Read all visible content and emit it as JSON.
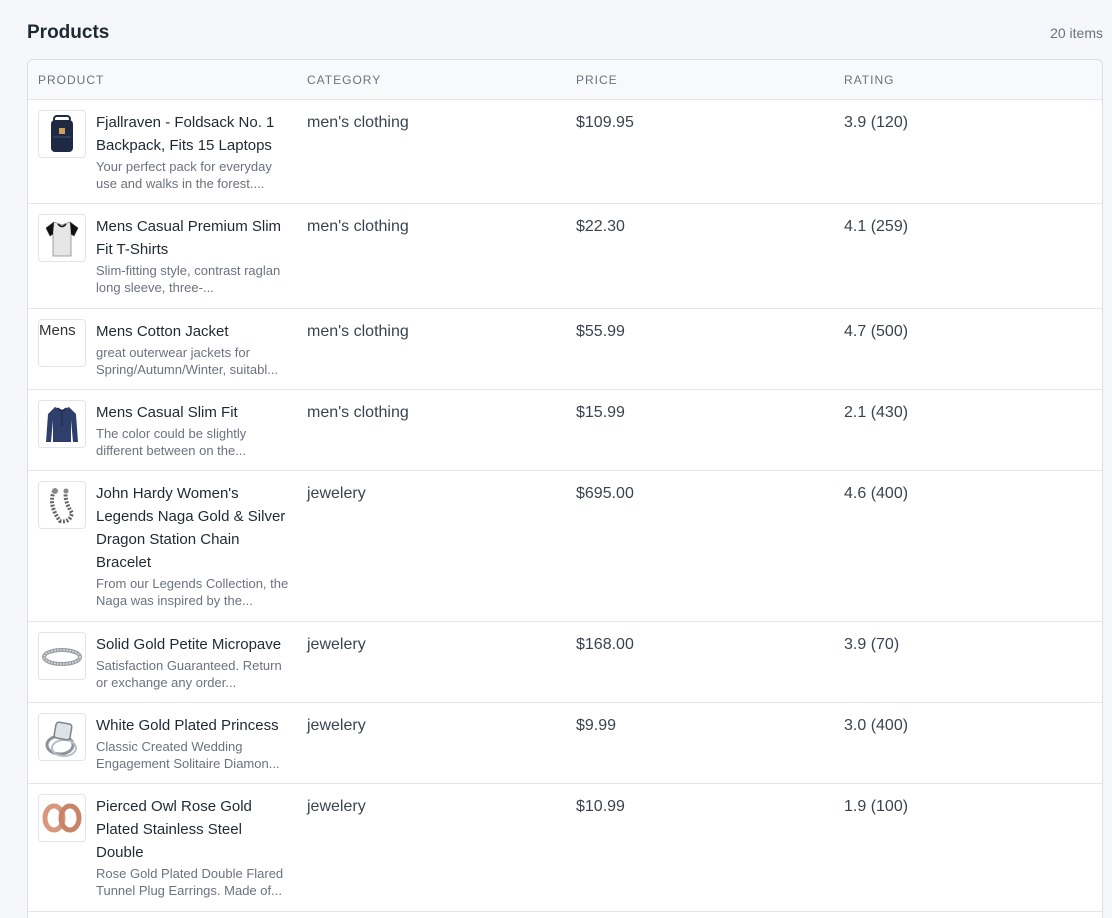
{
  "header": {
    "title": "Products",
    "count": "20 items"
  },
  "columns": {
    "product": "PRODUCT",
    "category": "CATEGORY",
    "price": "PRICE",
    "rating": "RATING"
  },
  "rows": [
    {
      "name": "Fjallraven - Foldsack No. 1 Backpack, Fits 15 Laptops",
      "desc": "Your perfect pack for everyday use and walks in the forest....",
      "category": "men's clothing",
      "price": "$109.95",
      "rating": "3.9 (120)",
      "icon": "backpack-image"
    },
    {
      "name": "Mens Casual Premium Slim Fit T-Shirts",
      "desc": "Slim-fitting style, contrast raglan long sleeve, three-...",
      "category": "men's clothing",
      "price": "$22.30",
      "rating": "4.1 (259)",
      "icon": "tshirt-image"
    },
    {
      "name": "Mens Cotton Jacket",
      "desc": "great outerwear jackets for Spring/Autumn/Winter, suitabl...",
      "category": "men's clothing",
      "price": "$55.99",
      "rating": "4.7 (500)",
      "icon": "broken-image",
      "alt": "Mens"
    },
    {
      "name": "Mens Casual Slim Fit",
      "desc": "The color could be slightly different between on the...",
      "category": "men's clothing",
      "price": "$15.99",
      "rating": "2.1 (430)",
      "icon": "longsleeve-image"
    },
    {
      "name": "John Hardy Women's Legends Naga Gold & Silver Dragon Station Chain Bracelet",
      "desc": "From our Legends Collection, the Naga was inspired by the...",
      "category": "jewelery",
      "price": "$695.00",
      "rating": "4.6 (400)",
      "icon": "bracelet-image"
    },
    {
      "name": "Solid Gold Petite Micropave",
      "desc": "Satisfaction Guaranteed. Return or exchange any order...",
      "category": "jewelery",
      "price": "$168.00",
      "rating": "3.9 (70)",
      "icon": "micropave-ring-image"
    },
    {
      "name": "White Gold Plated Princess",
      "desc": "Classic Created Wedding Engagement Solitaire Diamon...",
      "category": "jewelery",
      "price": "$9.99",
      "rating": "3.0 (400)",
      "icon": "diamond-ring-image"
    },
    {
      "name": "Pierced Owl Rose Gold Plated Stainless Steel Double",
      "desc": "Rose Gold Plated Double Flared Tunnel Plug Earrings. Made of...",
      "category": "jewelery",
      "price": "$10.99",
      "rating": "1.9 (100)",
      "icon": "earrings-image"
    }
  ]
}
